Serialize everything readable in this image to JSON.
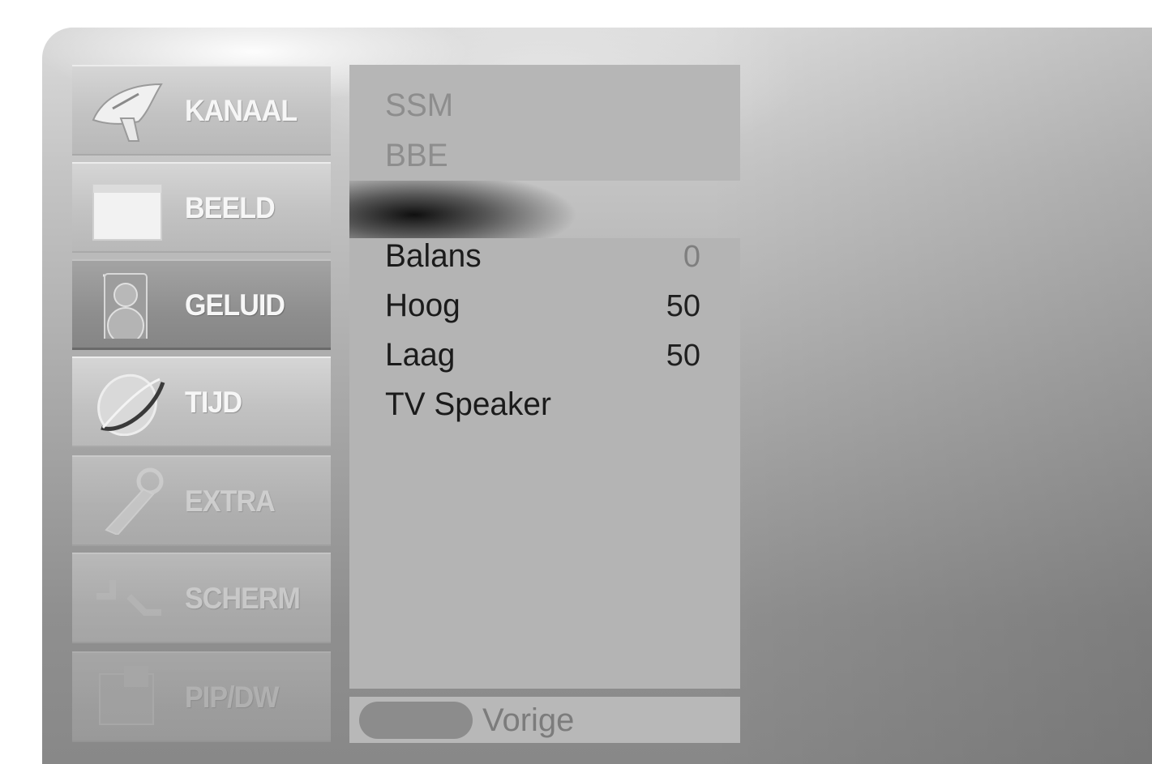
{
  "menu": {
    "items": [
      {
        "label": "KANAAL",
        "icon": "satellite-dish-icon"
      },
      {
        "label": "BEELD",
        "icon": "tv-picture-icon"
      },
      {
        "label": "GELUID",
        "icon": "speaker-icon"
      },
      {
        "label": "TIJD",
        "icon": "clock-icon"
      },
      {
        "label": "EXTRA",
        "icon": "key-tag-icon"
      },
      {
        "label": "SCHERM",
        "icon": "screen-arrows-icon"
      },
      {
        "label": "PIP/DW",
        "icon": "pip-icon"
      }
    ],
    "active": "GELUID"
  },
  "submenu": {
    "top_items": [
      {
        "label": "SSM"
      },
      {
        "label": "BBE"
      }
    ],
    "items": [
      {
        "label": "Balans",
        "value": "0"
      },
      {
        "label": "Hoog",
        "value": "50"
      },
      {
        "label": "Laag",
        "value": "50"
      },
      {
        "label": "TV Speaker",
        "value": ""
      }
    ]
  },
  "footer": {
    "back_label": "Vorige"
  }
}
